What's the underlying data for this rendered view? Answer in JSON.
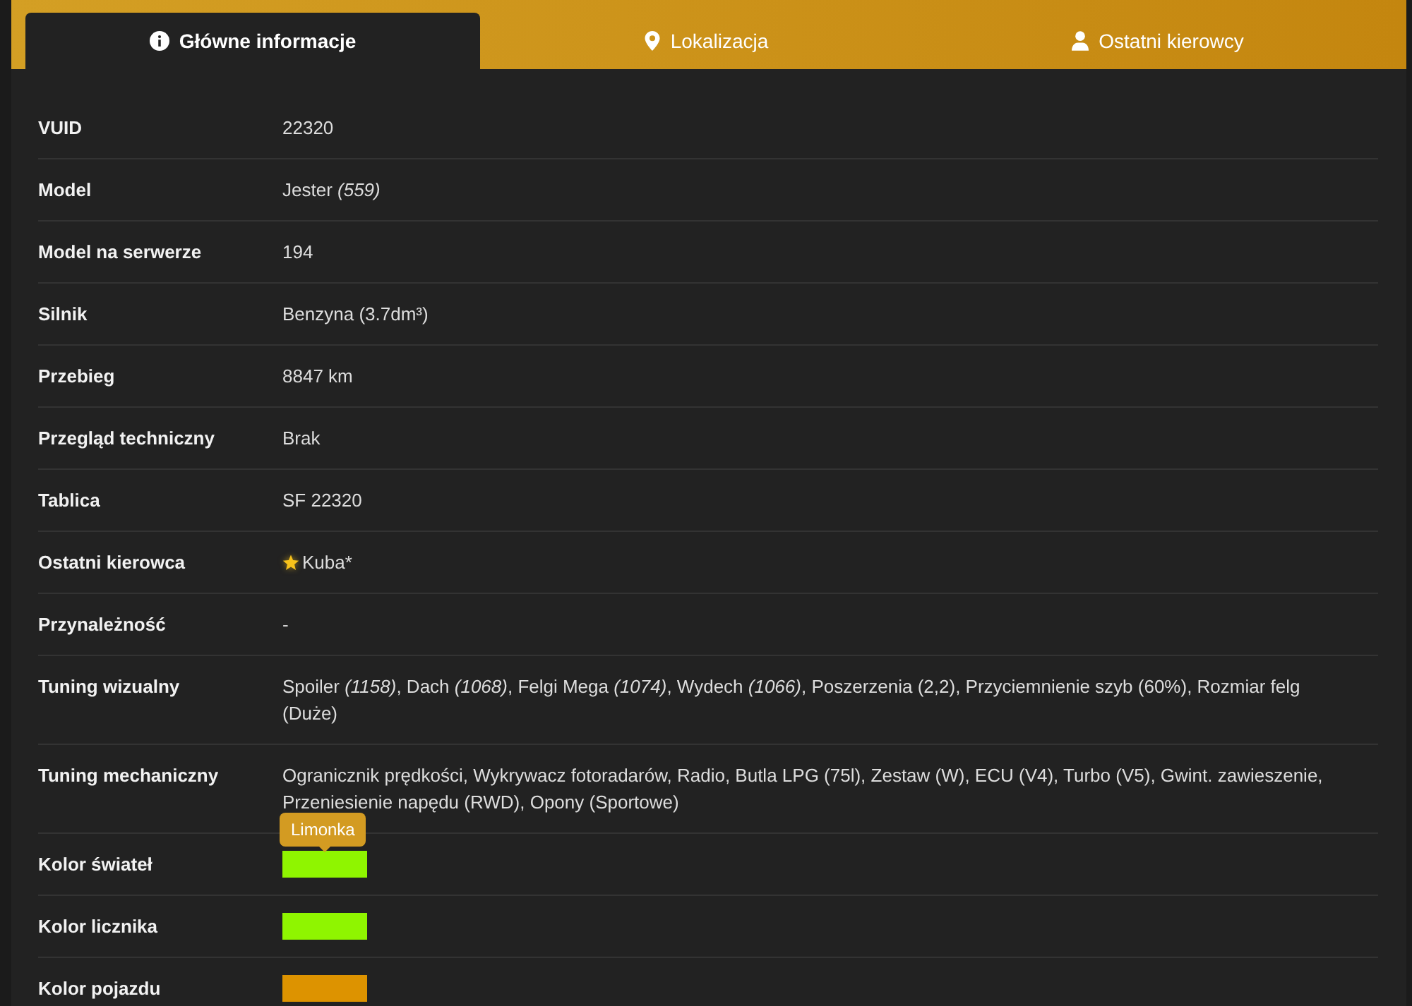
{
  "tabs": [
    {
      "label": "Główne informacje",
      "selected": true
    },
    {
      "label": "Lokalizacja",
      "selected": false
    },
    {
      "label": "Ostatni kierowcy",
      "selected": false
    }
  ],
  "rows": [
    {
      "kind": "text",
      "label": "VUID",
      "value": "22320"
    },
    {
      "kind": "text",
      "label": "Model",
      "value": "Jester *(559)*"
    },
    {
      "kind": "text",
      "label": "Model na serwerze",
      "value": "194"
    },
    {
      "kind": "text",
      "label": "Silnik",
      "value": "Benzyna (3.7dm³)"
    },
    {
      "kind": "text",
      "label": "Przebieg",
      "value": "8847 km"
    },
    {
      "kind": "text",
      "label": "Przegląd techniczny",
      "value": "Brak"
    },
    {
      "kind": "text",
      "label": "Tablica",
      "value": "SF 22320"
    },
    {
      "kind": "driver",
      "label": "Ostatni kierowca",
      "value": "Kuba*",
      "starred": true
    },
    {
      "kind": "text",
      "label": "Przynależność",
      "value": "-"
    },
    {
      "kind": "text",
      "label": "Tuning wizualny",
      "value": "Spoiler *(1158)*, Dach *(1068)*, Felgi Mega *(1074)*, Wydech *(1066)*, Poszerzenia (2,2), Przyciemnienie szyb (60%), Rozmiar felg (Duże)"
    },
    {
      "kind": "text",
      "label": "Tuning mechaniczny",
      "value": "Ogranicznik prędkości, Wykrywacz fotoradarów, Radio, Butla LPG (75l), Zestaw (W), ECU (V4), Turbo (V5), Gwint. zawieszenie, Przeniesienie napędu (RWD), Opony (Sportowe)"
    },
    {
      "kind": "color",
      "label": "Kolor świateł",
      "color": "#8ff500",
      "tooltip": "Limonka"
    },
    {
      "kind": "color",
      "label": "Kolor licznika",
      "color": "#8ff500"
    },
    {
      "kind": "color",
      "label": "Kolor pojazdu",
      "color": "#dd9300"
    }
  ]
}
